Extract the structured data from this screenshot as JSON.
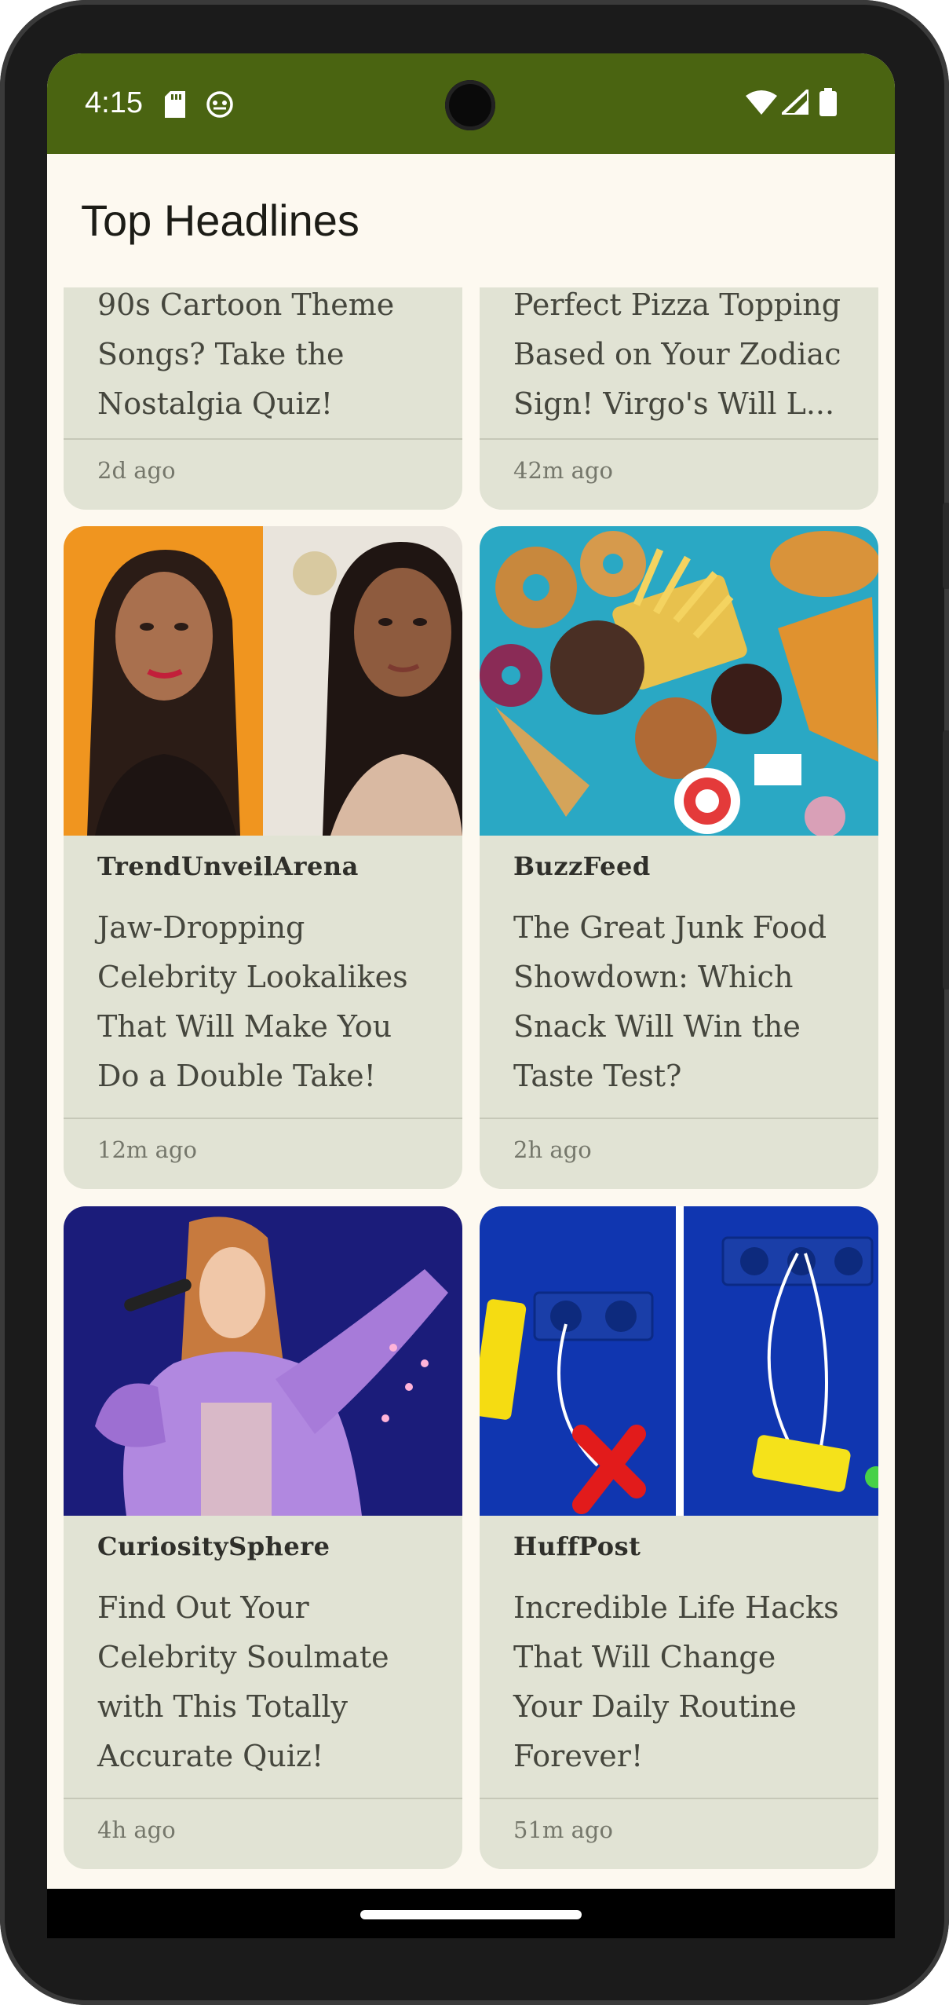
{
  "status_bar": {
    "time": "4:15",
    "background": "#4a6411",
    "left_icons": [
      "sd-card-icon",
      "android-debug-icon"
    ],
    "right_icons": [
      "wifi-icon",
      "cell-signal-icon",
      "battery-icon"
    ]
  },
  "app_bar": {
    "title": "Top Headlines"
  },
  "feed": {
    "partial_cards": [
      {
        "headline": "90s Cartoon Theme Songs? Take the Nostalgia Quiz!",
        "lines": [
          "90s Cartoon Theme",
          "Songs? Take the",
          "Nostalgia Quiz!"
        ],
        "time": "2d ago"
      },
      {
        "headline": "Perfect Pizza Topping Based on Your Zodiac Sign! Virgo's Will L...",
        "lines": [
          "Perfect Pizza Topping",
          "Based on Your Zodiac",
          "Sign! Virgo's Will L..."
        ],
        "time": "42m ago"
      }
    ],
    "cards": [
      {
        "image": "two-celebrities-side-by-side-image",
        "source": "TrendUnveilArena",
        "lines": [
          "Jaw-Dropping",
          "Celebrity Lookalikes",
          "That Will Make You",
          "Do a Double Take!"
        ],
        "time": "12m ago"
      },
      {
        "image": "junk-food-spread-image",
        "source": "BuzzFeed",
        "lines": [
          "The Great Junk Food",
          "Showdown: Which",
          "Snack Will Win the",
          "Taste Test?"
        ],
        "time": "2h ago"
      },
      {
        "image": "singer-in-purple-fur-coat-image",
        "source": "CuriositySphere",
        "lines": [
          "Find Out Your",
          "Celebrity Soulmate",
          "with This Totally",
          "Accurate Quiz!"
        ],
        "time": "4h ago"
      },
      {
        "image": "phone-charging-hack-image",
        "source": "HuffPost",
        "lines": [
          "Incredible Life Hacks",
          "That Will Change",
          "Your Daily Routine",
          "Forever!"
        ],
        "time": "51m ago"
      }
    ]
  },
  "colors": {
    "card_background": "#e1e3d4",
    "page_background": "#fdf9f0",
    "text_primary": "#45463d"
  }
}
